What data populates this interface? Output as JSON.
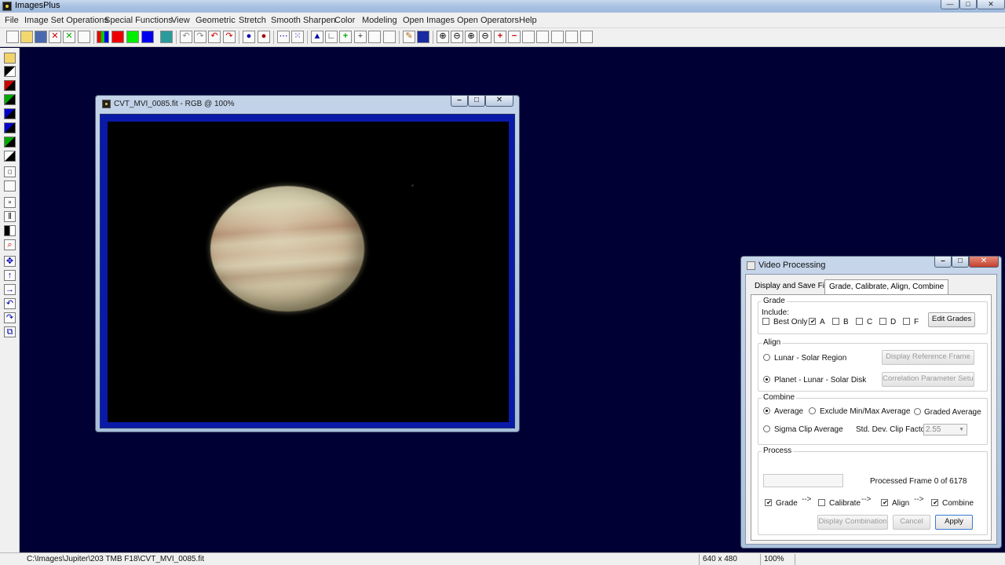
{
  "app": {
    "title": "ImagesPlus"
  },
  "menu": [
    "File",
    "Image Set Operations",
    "Special Functions",
    "View",
    "Geometric",
    "Stretch",
    "Smooth Sharpen",
    "Color",
    "Modeling",
    "Open Images",
    "Open Operators",
    "Help"
  ],
  "image_window": {
    "title": "CVT_MVI_0085.fit - RGB @ 100%"
  },
  "dialog": {
    "title": "Video Processing",
    "tabs": [
      "Display and Save Files",
      "Grade, Calibrate, Align,  Combine"
    ],
    "grade": {
      "label": "Grade",
      "include_label": "Include:",
      "best_only": "Best Only",
      "grades": [
        "A",
        "B",
        "C",
        "D",
        "F"
      ],
      "edit_button": "Edit Grades"
    },
    "align": {
      "label": "Align",
      "option_region": "Lunar - Solar Region",
      "option_disk": "Planet - Lunar - Solar Disk",
      "display_ref_button": "Display Reference Frame",
      "correlation_button": "Correlation Parameter Setup"
    },
    "combine": {
      "label": "Combine",
      "average": "Average",
      "exclude": "Exclude Min/Max Average",
      "graded": "Graded Average",
      "sigma": "Sigma Clip Average",
      "std_label": "Std. Dev. Clip Factor:",
      "std_value": "2.55"
    },
    "process": {
      "label": "Process",
      "status": "Processed Frame 0 of 6178",
      "grade": "Grade",
      "calibrate": "Calibrate",
      "align": "Align",
      "combine": "Combine",
      "arrow": "-->",
      "display_combination": "Display Combination",
      "cancel": "Cancel",
      "apply": "Apply"
    }
  },
  "status": {
    "path": "C:\\Images\\Jupiter\\203 TMB F18\\CVT_MVI_0085.fit",
    "dimensions": "640 x 480",
    "zoom": "100%"
  }
}
